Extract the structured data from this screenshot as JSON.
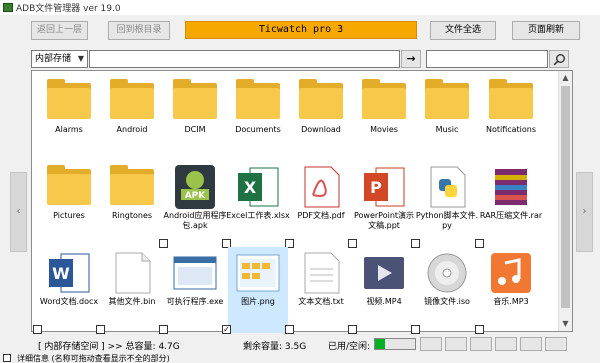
{
  "window": {
    "title": "ADB文件管理器 ver 19.0"
  },
  "toolbar": {
    "back_label": "返回上一层",
    "root_label": "回到根目录",
    "device_label": "Ticwatch pro 3",
    "select_all_label": "文件全选",
    "refresh_label": "页面刷新"
  },
  "addressbar": {
    "storage_selected": "内部存储",
    "go_symbol": "→"
  },
  "files": [
    {
      "name": "Alarms",
      "type": "folder"
    },
    {
      "name": "Android",
      "type": "folder"
    },
    {
      "name": "DCIM",
      "type": "folder"
    },
    {
      "name": "Documents",
      "type": "folder"
    },
    {
      "name": "Download",
      "type": "folder"
    },
    {
      "name": "Movies",
      "type": "folder"
    },
    {
      "name": "Music",
      "type": "folder"
    },
    {
      "name": "Notifications",
      "type": "folder"
    },
    {
      "name": "Pictures",
      "type": "folder"
    },
    {
      "name": "Ringtones",
      "type": "folder"
    },
    {
      "name": "Android应用程序包.apk",
      "type": "apk",
      "checked": false
    },
    {
      "name": "Excel工作表.xlsx",
      "type": "xlsx",
      "checked": false
    },
    {
      "name": "PDF文档.pdf",
      "type": "pdf",
      "checked": false
    },
    {
      "name": "PowerPoint演示文稿.ppt",
      "type": "ppt",
      "checked": false
    },
    {
      "name": "Python脚本文件.py",
      "type": "py",
      "checked": false
    },
    {
      "name": "RAR压缩文件.rar",
      "type": "rar",
      "checked": false
    },
    {
      "name": "Word文档.docx",
      "type": "docx",
      "checked": false
    },
    {
      "name": "其他文件.bin",
      "type": "bin",
      "checked": false
    },
    {
      "name": "可执行程序.exe",
      "type": "exe",
      "checked": false
    },
    {
      "name": "图片.png",
      "type": "png",
      "checked": true,
      "selected": true
    },
    {
      "name": "文本文档.txt",
      "type": "txt",
      "checked": false
    },
    {
      "name": "视频.MP4",
      "type": "mp4",
      "checked": false
    },
    {
      "name": "镜像文件.iso",
      "type": "iso",
      "checked": false
    },
    {
      "name": "音乐.MP3",
      "type": "mp3",
      "checked": false
    }
  ],
  "status": {
    "location": "[ 内部存储空间 ] >> 总容量: 4.7G",
    "free": "剩余容量: 3.5G",
    "used_label": "已用/空闲:",
    "used_fraction": 0.26
  },
  "log": {
    "label": "详细信息 (名称可拖动查看显示不全的部分)"
  },
  "colors": {
    "device_bar": "#f7a800",
    "folder": "#f7c84a",
    "selection": "#cde8ff",
    "progress": "#06b025"
  },
  "icons": {
    "nav_left": "‹",
    "nav_right": "›",
    "scroll_up": "▲",
    "scroll_down": "▼",
    "dropdown": "▼",
    "search": "search-icon"
  }
}
